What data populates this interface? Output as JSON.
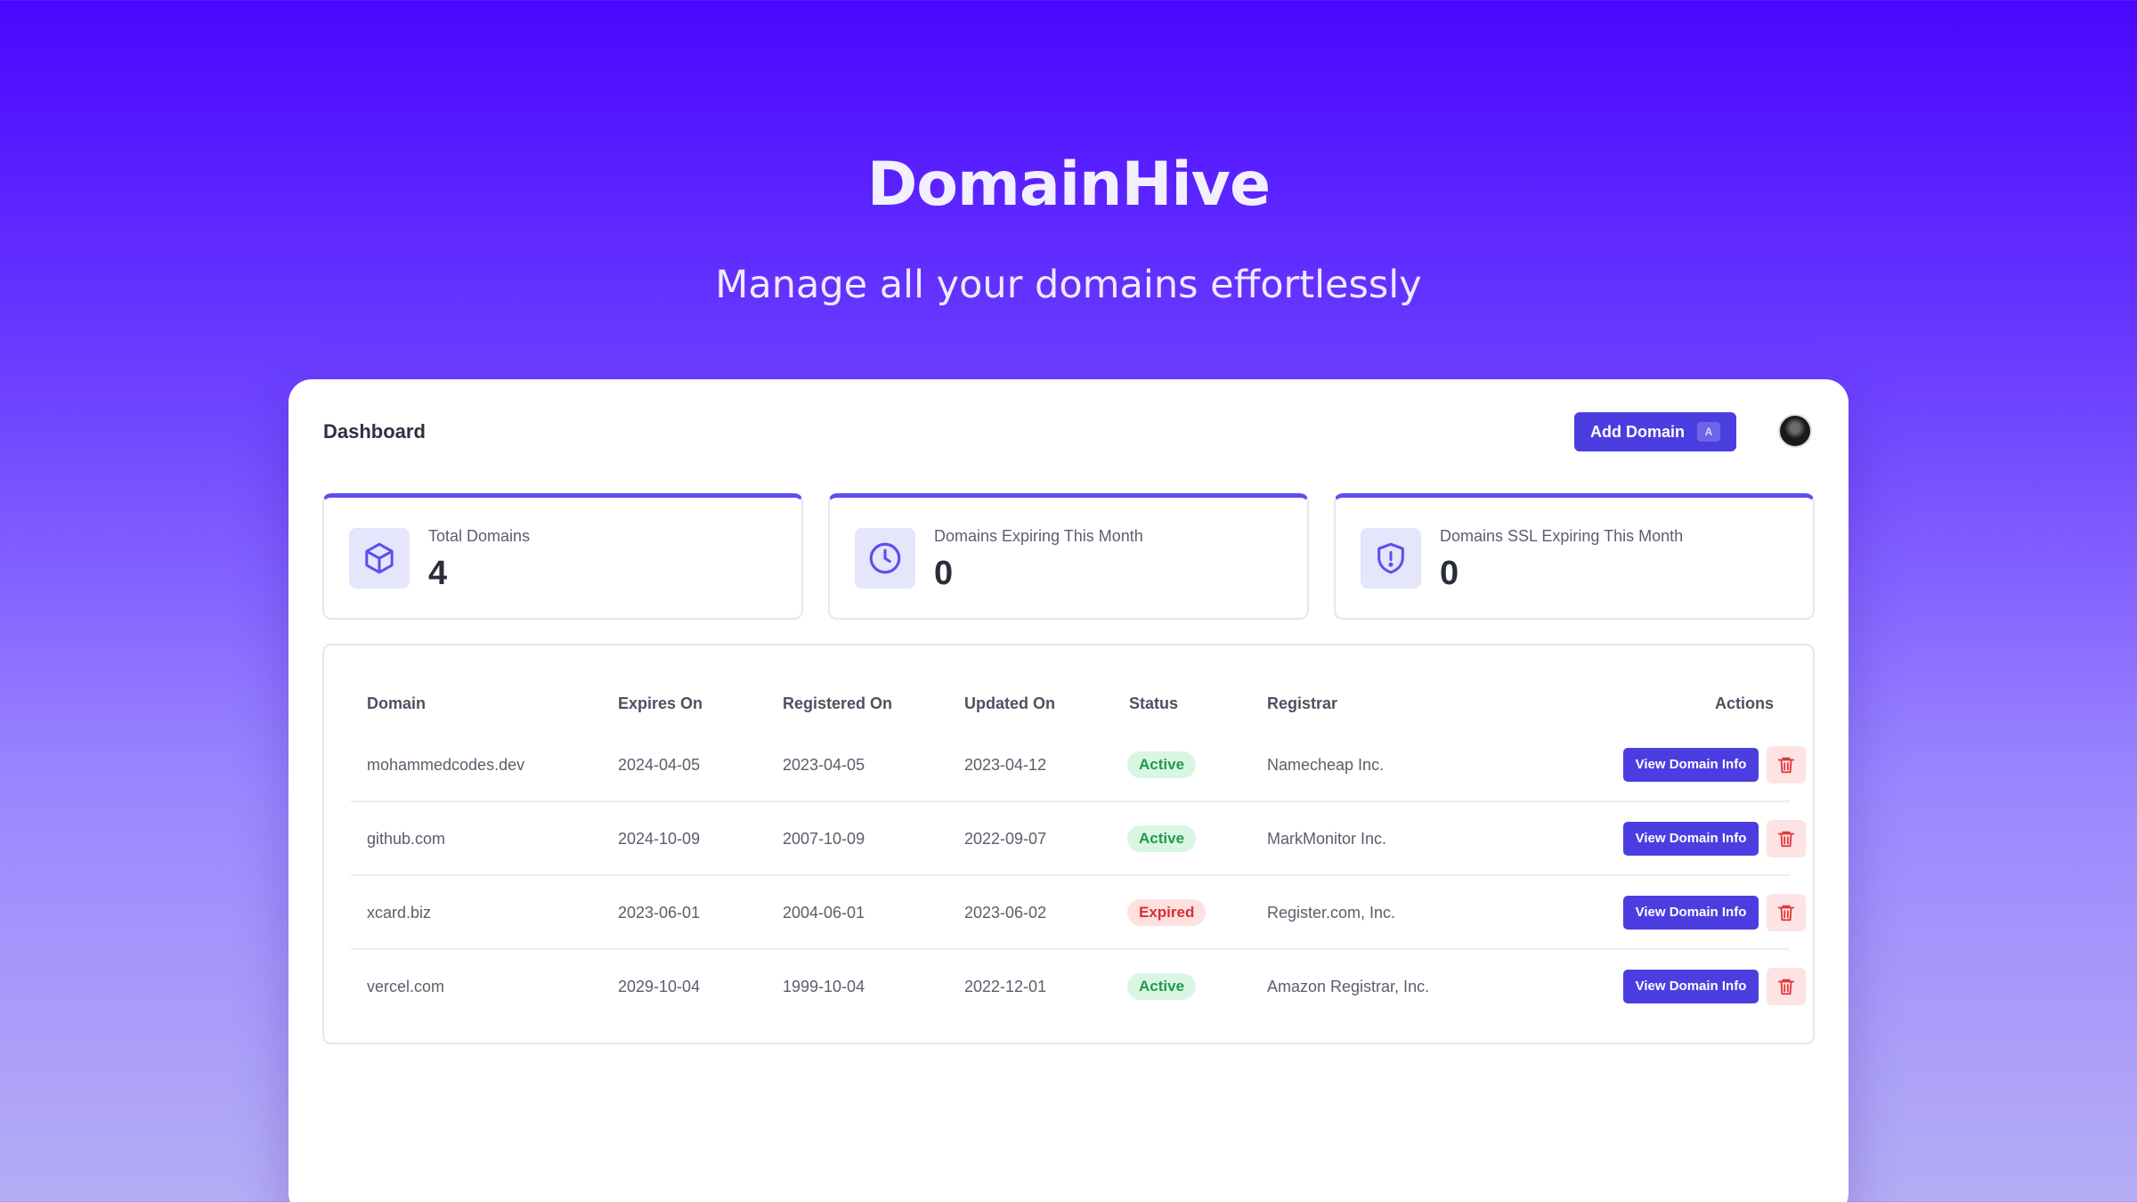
{
  "hero": {
    "title": "DomainHive",
    "subtitle": "Manage all your domains effortlessly"
  },
  "topbar": {
    "title": "Dashboard",
    "add_button": "Add Domain",
    "add_shortcut": "A"
  },
  "stats": [
    {
      "label": "Total Domains",
      "value": "4",
      "icon": "cube-icon"
    },
    {
      "label": "Domains Expiring This Month",
      "value": "0",
      "icon": "clock-icon"
    },
    {
      "label": "Domains SSL Expiring This Month",
      "value": "0",
      "icon": "shield-alert-icon"
    }
  ],
  "table": {
    "headers": {
      "domain": "Domain",
      "expires": "Expires On",
      "registered": "Registered On",
      "updated": "Updated On",
      "status": "Status",
      "registrar": "Registrar",
      "actions": "Actions"
    },
    "rows": [
      {
        "domain": "mohammedcodes.dev",
        "expires": "2024-04-05",
        "registered": "2023-04-05",
        "updated": "2023-04-12",
        "status": "Active",
        "registrar": "Namecheap Inc.",
        "action": "View Domain Info"
      },
      {
        "domain": "github.com",
        "expires": "2024-10-09",
        "registered": "2007-10-09",
        "updated": "2022-09-07",
        "status": "Active",
        "registrar": "MarkMonitor Inc.",
        "action": "View Domain Info"
      },
      {
        "domain": "xcard.biz",
        "expires": "2023-06-01",
        "registered": "2004-06-01",
        "updated": "2023-06-02",
        "status": "Expired",
        "registrar": "Register.com, Inc.",
        "action": "View Domain Info"
      },
      {
        "domain": "vercel.com",
        "expires": "2029-10-04",
        "registered": "1999-10-04",
        "updated": "2022-12-01",
        "status": "Active",
        "registrar": "Amazon Registrar, Inc.",
        "action": "View Domain Info"
      }
    ]
  },
  "colors": {
    "accent": "#4b3ee0",
    "active": "#1f9a4c",
    "expired": "#d93030"
  }
}
